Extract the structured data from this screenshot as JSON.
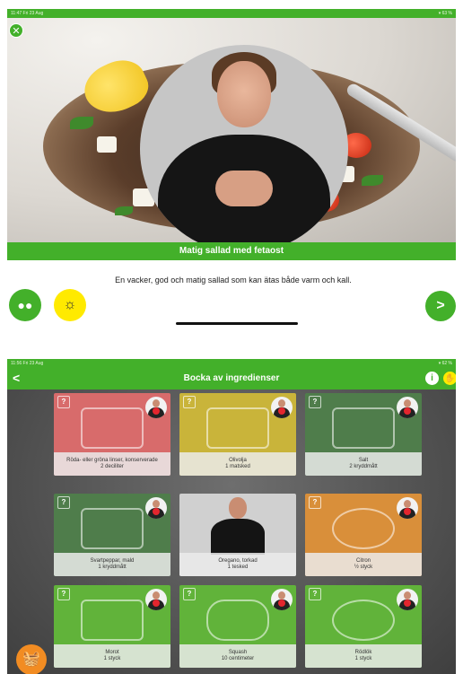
{
  "screen1": {
    "status_time": "11:47  Fri 23 Aug",
    "status_right": "▾ 63 %",
    "title": "Matig sallad med fetaost",
    "description": "En vacker, god och matig sallad som kan ätas både varm och kall.",
    "icons": {
      "close": "close-icon",
      "people": "people-icon",
      "lightbulb": "lightbulb-icon",
      "next": "chevron-right-icon"
    }
  },
  "screen2": {
    "status_time": "11:56  Fri 23 Aug",
    "status_right": "▾ 62 %",
    "header_title": "Bocka av ingredienser",
    "back_label": "<",
    "info_label": "i",
    "ingredients": [
      {
        "name": "Röda- eller gröna linser, konserverade",
        "amount": "2 deciliter",
        "color": "#d86b6b"
      },
      {
        "name": "Olivolja",
        "amount": "1 matsked",
        "color": "#c9b43a"
      },
      {
        "name": "Salt",
        "amount": "2 kryddmått",
        "color": "#4f7d4b"
      },
      {
        "name": "Svartpeppar, mald",
        "amount": "1 kryddmått",
        "color": "#4f7d4b"
      },
      {
        "name": "Oregano, torkad",
        "amount": "1 tesked",
        "color": "#d0d0d0"
      },
      {
        "name": "Citron",
        "amount": "½ styck",
        "color": "#d98f3a"
      },
      {
        "name": "Morot",
        "amount": "1 styck",
        "color": "#61b33a"
      },
      {
        "name": "Squash",
        "amount": "10 centimeter",
        "color": "#61b33a"
      },
      {
        "name": "Rödlök",
        "amount": "1 styck",
        "color": "#61b33a"
      }
    ],
    "accent_color": "#43b02a",
    "basket_icon": "basket-icon"
  }
}
